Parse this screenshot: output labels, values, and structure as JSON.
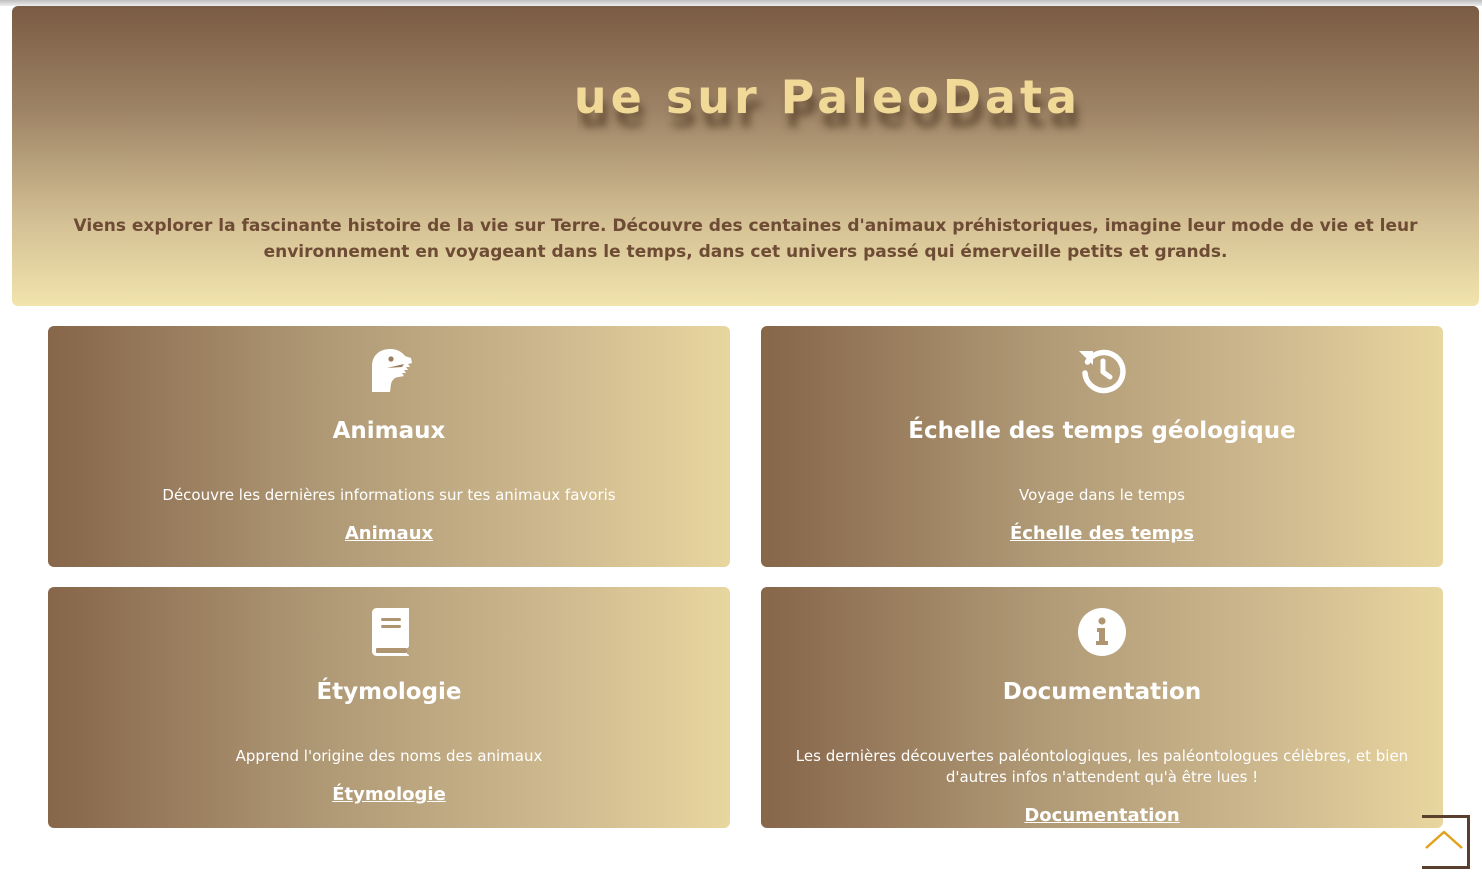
{
  "hero": {
    "title": "Bienvenue sur PaleoData",
    "subtitle": "Viens explorer la fascinante histoire de la vie sur Terre. Découvre des centaines d'animaux préhistoriques, imagine leur mode de vie et leur environnement en voyageant dans le temps, dans cet univers passé qui émerveille petits et grands."
  },
  "cards": [
    {
      "icon": "dinosaur-icon",
      "title": "Animaux",
      "description": "Découvre les dernières informations sur tes animaux favoris",
      "link": "Animaux"
    },
    {
      "icon": "history-icon",
      "title": "Échelle des temps géologique",
      "description": "Voyage dans le temps",
      "link": "Échelle des temps"
    },
    {
      "icon": "book-icon",
      "title": "Étymologie",
      "description": "Apprend l'origine des noms des animaux",
      "link": "Étymologie"
    },
    {
      "icon": "info-icon",
      "title": "Documentation",
      "description": "Les dernières découvertes paléontologiques, les paléontologues célèbres, et bien d'autres infos n'attendent qu'à être lues !",
      "link": "Documentation"
    }
  ],
  "back_to_top": {
    "icon": "chevron-up-icon"
  },
  "colors": {
    "hero_title": "#f1d998",
    "hero_subtitle": "#6e4b34",
    "card_text": "#ffffff",
    "accent": "#e0a21a"
  }
}
